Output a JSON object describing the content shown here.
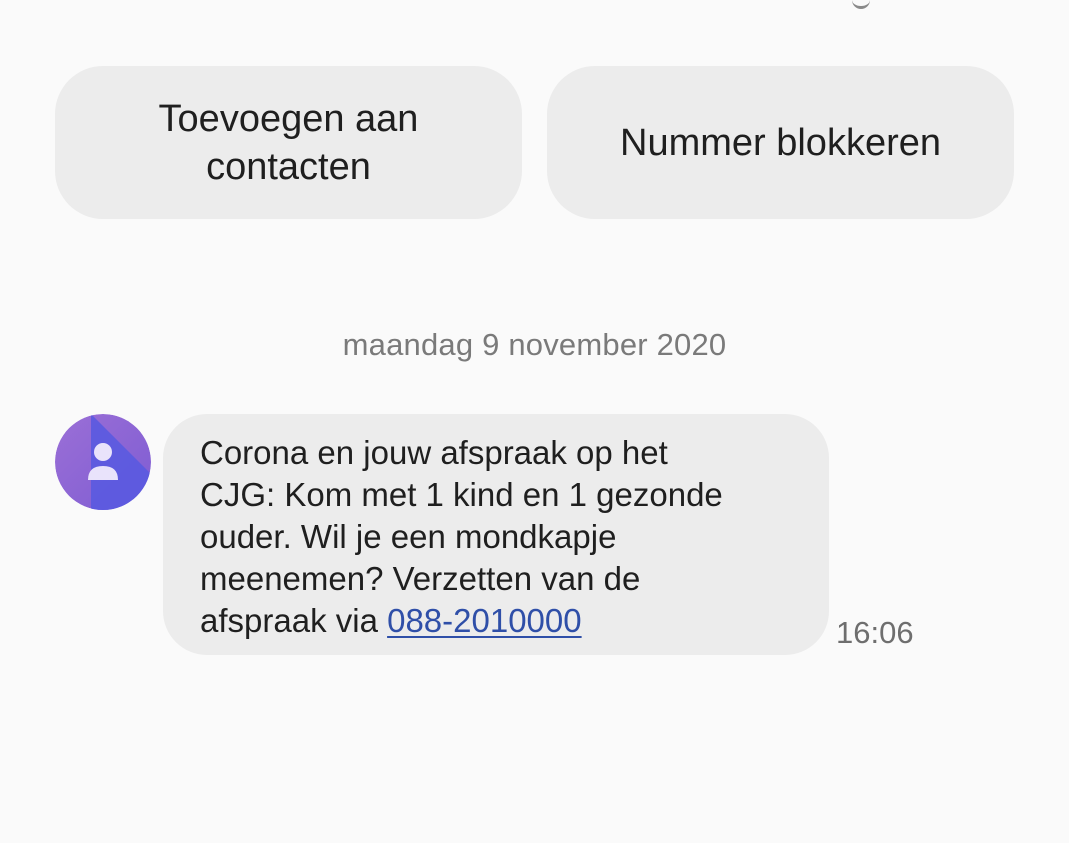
{
  "actions": {
    "add_to_contacts": "Toevoegen aan\ncontacten",
    "block_number": "Nummer blokkeren"
  },
  "conversation": {
    "date_separator": "maandag 9 november 2020",
    "messages": [
      {
        "sender_avatar_icon": "person-icon",
        "text": "Corona en jouw afspraak op het\nCJG: Kom met 1 kind en 1 gezonde\nouder. Wil je een mondkapje\nmeenemen? Verzetten van de\nafspraak via ",
        "link_text": "088-2010000",
        "time": "16:06"
      }
    ]
  },
  "colors": {
    "background": "#fafafa",
    "bubble": "#ececec",
    "link": "#2f4fa8",
    "avatar_light": "#8a63d8",
    "avatar_dark": "#4f57e0"
  }
}
